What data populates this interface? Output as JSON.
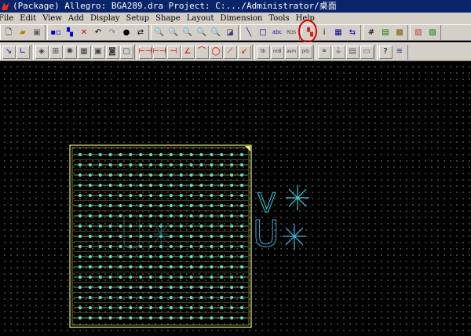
{
  "window": {
    "title": "(Package) Allegro: BGA289.dra  Project: C:.../Administrator/桌面"
  },
  "menu": [
    {
      "label": "File",
      "id": "file"
    },
    {
      "label": "Edit",
      "id": "edit"
    },
    {
      "label": "View",
      "id": "view"
    },
    {
      "label": "Add",
      "id": "add"
    },
    {
      "label": "Display",
      "id": "display"
    },
    {
      "label": "Setup",
      "id": "setup"
    },
    {
      "label": "Shape",
      "id": "shape"
    },
    {
      "label": "Layout",
      "id": "layout"
    },
    {
      "label": "Dimension",
      "id": "dimension"
    },
    {
      "label": "Tools",
      "id": "tools"
    },
    {
      "label": "Help",
      "id": "help"
    }
  ],
  "toolbar_row1": [
    [
      "new-icon",
      "open-icon",
      "save-icon"
    ],
    [
      "move-icon",
      "copy-icon",
      "delete-icon",
      "undo-icon",
      "redo-icon",
      "pin-icon",
      "swap-icon"
    ],
    [
      "zoom-points-icon",
      "zoom-in-icon",
      "zoom-out-icon",
      "zoom-fit-icon",
      "zoom-previous-icon",
      "shade-3d-icon"
    ],
    [
      "add-line-icon",
      "add-rectangle-icon",
      "add-text-icon",
      "label-refdes-icon"
    ],
    [
      "color-icon",
      "info-icon",
      "measure-icon",
      "nets-icon"
    ],
    [
      "grid-icon",
      "layers-icon",
      "highlight-icon"
    ],
    [
      "property-icon",
      "board-icon"
    ]
  ],
  "toolbar_row2": [
    [
      "slide-icon",
      "vertex-icon"
    ],
    [
      "component-icon",
      "pad-icon",
      "place-icon",
      "array-icon",
      "package-icon",
      "via-icon",
      "symbol-icon"
    ],
    [
      "dim-linear-icon",
      "dim-datum-icon",
      "dim-angle-icon",
      "dim-chamfer-icon",
      "dim-arc-icon",
      "dim-radius-icon",
      "dim-diameter-icon",
      "dim-leader-icon"
    ],
    [
      "lib-icon",
      "mdl-icon",
      "asm-icon",
      "prb-icon"
    ],
    [
      "pkg-icon",
      "stamp-icon",
      "layout-icon",
      "db-icon"
    ],
    [
      "help-icon",
      "cadence-logo-icon"
    ]
  ],
  "toolbar_row2_text": {
    "lib": "lib",
    "mdl": "mdl",
    "asm": "asm",
    "prb": "prb"
  },
  "toolbar_row1_text": {
    "label_refdes": "RDS"
  },
  "canvas": {
    "background": "#000000",
    "grid_color": "#8a8a8a",
    "package_outline_color": "#e8f07a",
    "pad_color": "#5fe0c8",
    "text_color": "#3fd0d8",
    "letters": [
      "V",
      "U"
    ],
    "pad_rows": 17,
    "pad_cols": 17
  }
}
